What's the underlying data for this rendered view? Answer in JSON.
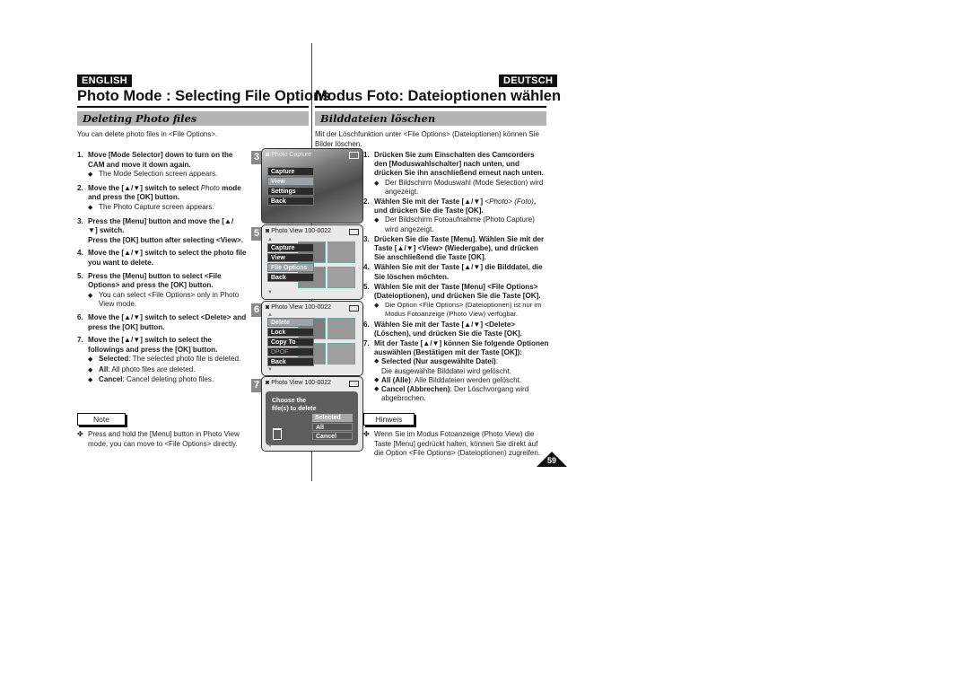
{
  "english": {
    "lang": "ENGLISH",
    "title": "Photo Mode : Selecting File Options",
    "section": "Deleting Photo files",
    "intro": "You can delete photo files in <File Options>.",
    "steps": [
      {
        "num": "1.",
        "text": "Move [Mode Selector] down to turn on the CAM and move it down again.",
        "bullets": [
          "The Mode Selection screen appears."
        ]
      },
      {
        "num": "2.",
        "text_pre": "Move the [▲/▼] switch to select ",
        "text_italic": "Photo",
        "text_post": " mode and press the [OK] button.",
        "bullets": [
          "The Photo Capture screen appears."
        ]
      },
      {
        "num": "3.",
        "text": "Press the [Menu] button and move the [▲/▼] switch.",
        "text2": "Press the [OK] button after selecting <View>."
      },
      {
        "num": "4.",
        "text": "Move the [▲/▼] switch to select the photo file you want to delete."
      },
      {
        "num": "5.",
        "text": "Press the [Menu] button to select <File Options> and press the [OK] button.",
        "bullets": [
          "You can select <File Options> only in Photo View mode."
        ]
      },
      {
        "num": "6.",
        "text": "Move the [▲/▼] switch to select <Delete> and press the [OK] button."
      },
      {
        "num": "7.",
        "text": "Move the [▲/▼] switch to select the followings and press the [OK] button.",
        "options": [
          {
            "term": "Selected",
            "desc": ": The selected photo file is deleted."
          },
          {
            "term": "All",
            "desc": ": All photo files are deleted."
          },
          {
            "term": "Cancel",
            "desc": ": Cancel deleting photo files."
          }
        ]
      }
    ],
    "note_label": "Note",
    "note_text": "Press and hold the [Menu] button in Photo View mode, you can move to <File Options> directly."
  },
  "deutsch": {
    "lang": "DEUTSCH",
    "title": "Modus Foto: Dateioptionen wählen",
    "section": "Bilddateien löschen",
    "intro": "Mit der Löschfunktion unter <File Options> (Dateioptionen) können Sie Bilder löschen.",
    "steps": [
      {
        "num": "1.",
        "text": "Drücken Sie zum Einschalten des Camcorders den [Moduswahlschalter] nach unten, und drücken Sie ihn anschließend erneut nach unten.",
        "bullets": [
          "Der Bildschirm Moduswahl (Mode Selection) wird angezeigt."
        ]
      },
      {
        "num": "2.",
        "text_pre": "Wählen Sie mit der Taste [▲/▼] ",
        "text_italic": "<Photo> (Foto)",
        "text_post": ", und drücken Sie die Taste [OK].",
        "bullets": [
          "Der Bildschirm Fotoaufnahme (Photo Capture) wird angezeigt."
        ]
      },
      {
        "num": "3.",
        "text": "Drücken Sie die Taste [Menu]. Wählen Sie mit der Taste [▲/▼] <View> (Wiedergabe), und drücken Sie anschließend die Taste [OK]."
      },
      {
        "num": "4.",
        "text": "Wählen Sie mit der Taste [▲/▼] die Bilddatei, die Sie löschen möchten."
      },
      {
        "num": "5.",
        "text": "Wählen Sie mit der Taste [Menu] <File Options> (Dateioptionen), und drücken Sie die Taste [OK].",
        "bullets": [
          "Die Option <File Options> (Dateioptionen) ist nur im Modus Fotoanzeige (Photo View) verfügbar."
        ]
      },
      {
        "num": "6.",
        "text": "Wählen Sie mit der Taste [▲/▼] <Delete> (Löschen), und drücken Sie die Taste [OK]."
      },
      {
        "num": "7.",
        "text": "Mit der Taste [▲/▼] können Sie folgende Optionen auswählen (Bestätigen mit der Taste [OK]):",
        "options": [
          {
            "term": "Selected (Nur ausgewählte Datei)",
            "desc": ":",
            "desc2": "Die ausgewählte Bilddatei wird gelöscht."
          },
          {
            "term": "All (Alle)",
            "desc": ": Alle Bilddateien werden gelöscht."
          },
          {
            "term": "Cancel (Abbrechen)",
            "desc": ": Der Löschvorgang wird abgebrochen."
          }
        ]
      }
    ],
    "note_label": "Hinweis",
    "note_text": "Wenn Sie im Modus Fotoanzeige (Photo View) die Taste [Menu] gedrückt halten, können Sie direkt auf die Option <File Options> (Dateioptionen) zugreifen."
  },
  "screens": [
    {
      "step": "3",
      "header": "Photo Capture",
      "menu": [
        "Capture",
        "View",
        "Settings",
        "Back"
      ],
      "selected": 1
    },
    {
      "step": "5",
      "header": "Photo View",
      "file": "100-0022",
      "menu": [
        "Capture",
        "View",
        "File Options",
        "Back"
      ],
      "selected": 2
    },
    {
      "step": "6",
      "header": "Photo View",
      "file": "100-0022",
      "menu": [
        "Delete",
        "Lock",
        "Copy To",
        "DPOF",
        "Back"
      ],
      "selected": 0,
      "dimmed": 3
    },
    {
      "step": "7",
      "header": "Photo View",
      "file": "100-0022",
      "prompt": "Choose the file(s) to delete",
      "options": [
        "Selected",
        "All",
        "Cancel"
      ],
      "selected": 0
    }
  ],
  "page_number": "59",
  "colors": {
    "section_bar": "#b3b3b3",
    "menu_bg": "#2b2b2b",
    "menu_selected": "#9ca3aa",
    "badge": "#111111"
  }
}
